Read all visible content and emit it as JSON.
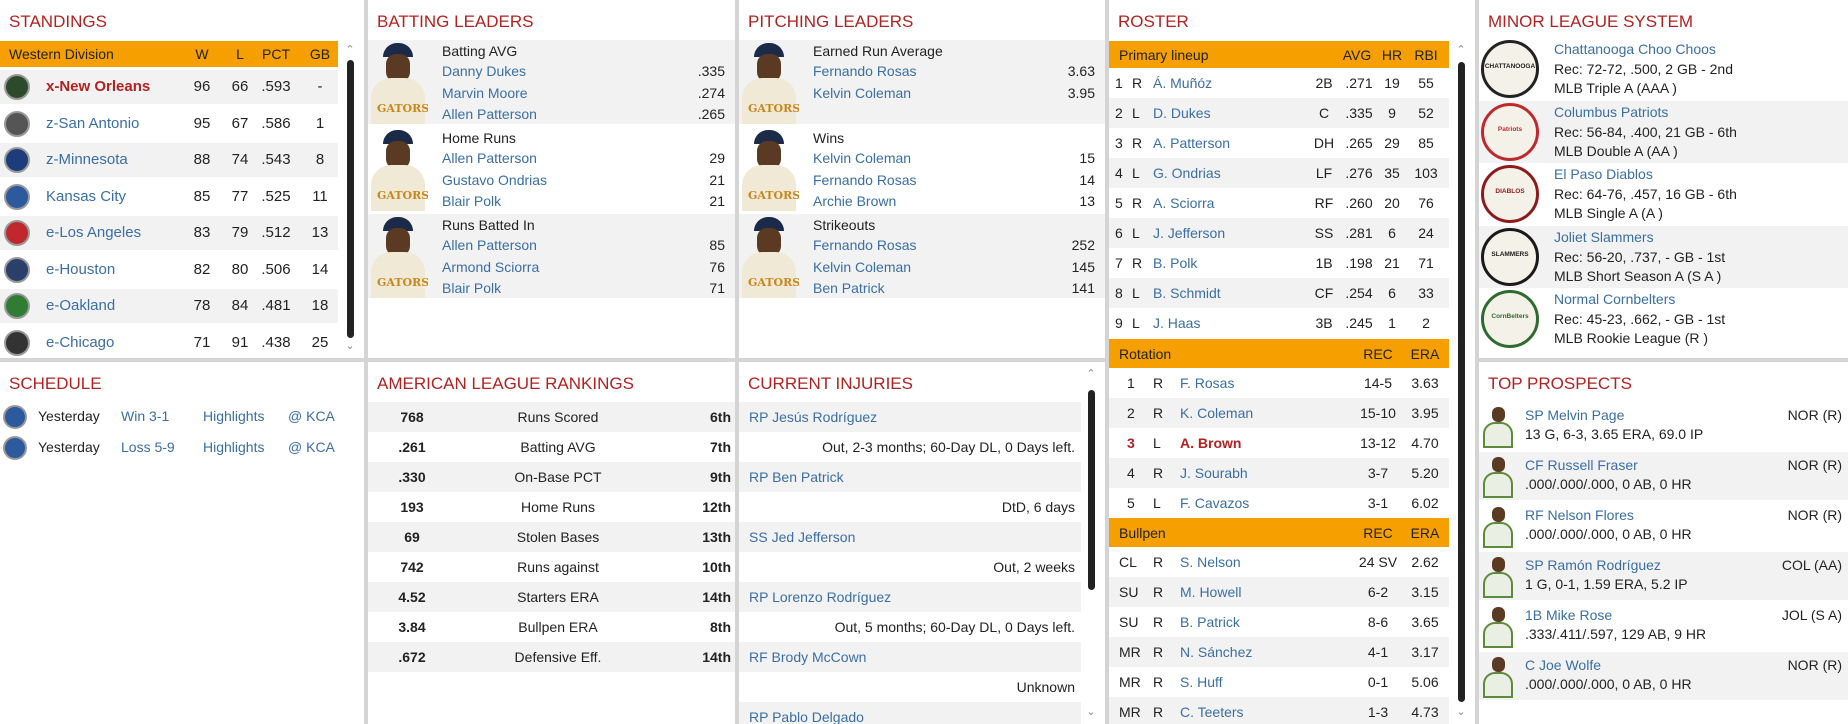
{
  "standings": {
    "title": "STANDINGS",
    "header": {
      "division": "Western Division",
      "w": "W",
      "l": "L",
      "pct": "PCT",
      "gb": "GB"
    },
    "rows": [
      {
        "team": "x-New Orleans",
        "w": "96",
        "l": "66",
        "pct": ".593",
        "gb": "-",
        "color": "#2e4a2c"
      },
      {
        "team": "z-San Antonio",
        "w": "95",
        "l": "67",
        "pct": ".586",
        "gb": "1",
        "color": "#555555"
      },
      {
        "team": "z-Minnesota",
        "w": "88",
        "l": "74",
        "pct": ".543",
        "gb": "8",
        "color": "#1d3c7a"
      },
      {
        "team": "Kansas City",
        "w": "85",
        "l": "77",
        "pct": ".525",
        "gb": "11",
        "color": "#2c5a9c"
      },
      {
        "team": "e-Los Angeles",
        "w": "83",
        "l": "79",
        "pct": ".512",
        "gb": "13",
        "color": "#c0282d"
      },
      {
        "team": "e-Houston",
        "w": "82",
        "l": "80",
        "pct": ".506",
        "gb": "14",
        "color": "#2b3f6b"
      },
      {
        "team": "e-Oakland",
        "w": "78",
        "l": "84",
        "pct": ".481",
        "gb": "18",
        "color": "#2e7d32"
      },
      {
        "team": "e-Chicago",
        "w": "71",
        "l": "91",
        "pct": ".438",
        "gb": "25",
        "color": "#333333"
      }
    ]
  },
  "batting": {
    "title": "BATTING LEADERS",
    "groups": [
      {
        "stat": "Batting AVG",
        "players": [
          {
            "name": "Danny Dukes",
            "val": ".335"
          },
          {
            "name": "Marvin Moore",
            "val": ".274"
          },
          {
            "name": "Allen Patterson",
            "val": ".265"
          }
        ]
      },
      {
        "stat": "Home Runs",
        "players": [
          {
            "name": "Allen Patterson",
            "val": "29"
          },
          {
            "name": "Gustavo Ondrias",
            "val": "21"
          },
          {
            "name": "Blair Polk",
            "val": "21"
          }
        ]
      },
      {
        "stat": "Runs Batted In",
        "players": [
          {
            "name": "Allen Patterson",
            "val": "85"
          },
          {
            "name": "Armond Sciorra",
            "val": "76"
          },
          {
            "name": "Blair Polk",
            "val": "71"
          }
        ]
      }
    ]
  },
  "pitching": {
    "title": "PITCHING LEADERS",
    "groups": [
      {
        "stat": "Earned Run Average",
        "players": [
          {
            "name": "Fernando Rosas",
            "val": "3.63"
          },
          {
            "name": "Kelvin Coleman",
            "val": "3.95"
          }
        ]
      },
      {
        "stat": "Wins",
        "players": [
          {
            "name": "Kelvin Coleman",
            "val": "15"
          },
          {
            "name": "Fernando Rosas",
            "val": "14"
          },
          {
            "name": "Archie Brown",
            "val": "13"
          }
        ]
      },
      {
        "stat": "Strikeouts",
        "players": [
          {
            "name": "Fernando Rosas",
            "val": "252"
          },
          {
            "name": "Kelvin Coleman",
            "val": "145"
          },
          {
            "name": "Ben Patrick",
            "val": "141"
          }
        ]
      }
    ]
  },
  "jersey_text": "GATORS",
  "roster": {
    "title": "ROSTER",
    "lineup_header": {
      "label": "Primary lineup",
      "c1": "AVG",
      "c2": "HR",
      "c3": "RBI"
    },
    "lineup": [
      {
        "n": "1",
        "h": "R",
        "name": "Á. Muñóz",
        "pos": "2B",
        "avg": ".271",
        "hr": "19",
        "rbi": "55"
      },
      {
        "n": "2",
        "h": "L",
        "name": "D. Dukes",
        "pos": "C",
        "avg": ".335",
        "hr": "9",
        "rbi": "52"
      },
      {
        "n": "3",
        "h": "R",
        "name": "A. Patterson",
        "pos": "DH",
        "avg": ".265",
        "hr": "29",
        "rbi": "85"
      },
      {
        "n": "4",
        "h": "L",
        "name": "G. Ondrias",
        "pos": "LF",
        "avg": ".276",
        "hr": "35",
        "rbi": "103"
      },
      {
        "n": "5",
        "h": "R",
        "name": "A. Sciorra",
        "pos": "RF",
        "avg": ".260",
        "hr": "20",
        "rbi": "76"
      },
      {
        "n": "6",
        "h": "L",
        "name": "J. Jefferson",
        "pos": "SS",
        "avg": ".281",
        "hr": "6",
        "rbi": "24"
      },
      {
        "n": "7",
        "h": "R",
        "name": "B. Polk",
        "pos": "1B",
        "avg": ".198",
        "hr": "21",
        "rbi": "71"
      },
      {
        "n": "8",
        "h": "L",
        "name": "B. Schmidt",
        "pos": "CF",
        "avg": ".254",
        "hr": "6",
        "rbi": "33"
      },
      {
        "n": "9",
        "h": "L",
        "name": "J. Haas",
        "pos": "3B",
        "avg": ".245",
        "hr": "1",
        "rbi": "2"
      }
    ],
    "rotation_header": {
      "label": "Rotation",
      "c1": "REC",
      "c2": "ERA"
    },
    "rotation": [
      {
        "n": "1",
        "h": "R",
        "name": "F. Rosas",
        "rec": "14-5",
        "era": "3.63"
      },
      {
        "n": "2",
        "h": "R",
        "name": "K. Coleman",
        "rec": "15-10",
        "era": "3.95"
      },
      {
        "n": "3",
        "h": "L",
        "name": "A. Brown",
        "rec": "13-12",
        "era": "4.70"
      },
      {
        "n": "4",
        "h": "R",
        "name": "J. Sourabh",
        "rec": "3-7",
        "era": "5.20"
      },
      {
        "n": "5",
        "h": "L",
        "name": "F. Cavazos",
        "rec": "3-1",
        "era": "6.02"
      }
    ],
    "bullpen_header": {
      "label": "Bullpen",
      "c1": "REC",
      "c2": "ERA"
    },
    "bullpen": [
      {
        "role": "CL",
        "h": "R",
        "name": "S. Nelson",
        "rec": "24 SV",
        "era": "2.62"
      },
      {
        "role": "SU",
        "h": "R",
        "name": "M. Howell",
        "rec": "6-2",
        "era": "3.15"
      },
      {
        "role": "SU",
        "h": "R",
        "name": "B. Patrick",
        "rec": "8-6",
        "era": "3.65"
      },
      {
        "role": "MR",
        "h": "R",
        "name": "N. Sánchez",
        "rec": "4-1",
        "era": "3.17"
      },
      {
        "role": "MR",
        "h": "R",
        "name": "S. Huff",
        "rec": "0-1",
        "era": "5.06"
      },
      {
        "role": "MR",
        "h": "R",
        "name": "C. Teeters",
        "rec": "1-3",
        "era": "4.73"
      }
    ]
  },
  "minors": {
    "title": "MINOR LEAGUE SYSTEM",
    "teams": [
      {
        "name": "Chattanooga Choo Choos",
        "rec": "Rec: 72-72, .500, 2 GB - 2nd",
        "level": "MLB Triple A (AAA )",
        "logo": "CHATTANOOGA",
        "color": "#222222"
      },
      {
        "name": "Columbus Patriots",
        "rec": "Rec: 56-84, .400, 21 GB - 6th",
        "level": "MLB Double A (AA )",
        "logo": "Patriots",
        "color": "#c0282d"
      },
      {
        "name": "El Paso Diablos",
        "rec": "Rec: 64-76, .457, 16 GB - 6th",
        "level": "MLB Single A (A )",
        "logo": "DIABLOS",
        "color": "#8e1b1b"
      },
      {
        "name": "Joliet Slammers",
        "rec": "Rec: 56-20, .737, - GB - 1st",
        "level": "MLB Short Season A (S A )",
        "logo": "SLAMMERS",
        "color": "#1a1a1a"
      },
      {
        "name": "Normal Cornbelters",
        "rec": "Rec: 45-23, .662, - GB - 1st",
        "level": "MLB Rookie League (R )",
        "logo": "CornBelters",
        "color": "#2e6b2e"
      }
    ]
  },
  "schedule": {
    "title": "SCHEDULE",
    "games": [
      {
        "when": "Yesterday",
        "result": "Win 3-1",
        "hl": "Highlights",
        "opp": "@ KCA"
      },
      {
        "when": "Yesterday",
        "result": "Loss 5-9",
        "hl": "Highlights",
        "opp": "@ KCA"
      }
    ]
  },
  "rankings": {
    "title": "AMERICAN LEAGUE RANKINGS",
    "rows": [
      {
        "val": "768",
        "stat": "Runs Scored",
        "rank": "6th"
      },
      {
        "val": ".261",
        "stat": "Batting AVG",
        "rank": "7th"
      },
      {
        "val": ".330",
        "stat": "On-Base PCT",
        "rank": "9th"
      },
      {
        "val": "193",
        "stat": "Home Runs",
        "rank": "12th"
      },
      {
        "val": "69",
        "stat": "Stolen Bases",
        "rank": "13th"
      },
      {
        "val": "742",
        "stat": "Runs against",
        "rank": "10th"
      },
      {
        "val": "4.52",
        "stat": "Starters ERA",
        "rank": "14th"
      },
      {
        "val": "3.84",
        "stat": "Bullpen ERA",
        "rank": "8th"
      },
      {
        "val": ".672",
        "stat": "Defensive Eff.",
        "rank": "14th"
      }
    ]
  },
  "injuries": {
    "title": "CURRENT INJURIES",
    "rows": [
      {
        "player": "RP Jesús Rodríguez",
        "status": "Out, 2-3 months; 60-Day DL, 0 Days left."
      },
      {
        "player": "RP Ben Patrick",
        "status": "DtD, 6 days"
      },
      {
        "player": "SS Jed Jefferson",
        "status": "Out, 2 weeks"
      },
      {
        "player": "RP Lorenzo Rodríguez",
        "status": "Out, 5 months; 60-Day DL, 0 Days left."
      },
      {
        "player": "RF Brody McCown",
        "status": "Unknown"
      },
      {
        "player": "RP Pablo Delgado",
        "status": ""
      }
    ]
  },
  "prospects": {
    "title": "TOP PROSPECTS",
    "rows": [
      {
        "name": "SP Melvin Page",
        "team": "NOR (R)",
        "line": "13 G, 6-3, 3.65 ERA, 69.0 IP"
      },
      {
        "name": "CF Russell Fraser",
        "team": "NOR (R)",
        "line": ".000/.000/.000, 0 AB, 0 HR"
      },
      {
        "name": "RF Nelson Flores",
        "team": "NOR (R)",
        "line": ".000/.000/.000, 0 AB, 0 HR"
      },
      {
        "name": "SP Ramón Rodríguez",
        "team": "COL (AA)",
        "line": "1 G, 0-1, 1.59 ERA, 5.2 IP"
      },
      {
        "name": "1B Mike Rose",
        "team": "JOL (S A)",
        "line": ".333/.411/.597, 129 AB, 9 HR"
      },
      {
        "name": "C Joe Wolfe",
        "team": "NOR (R)",
        "line": ".000/.000/.000, 0 AB, 0 HR"
      }
    ]
  }
}
